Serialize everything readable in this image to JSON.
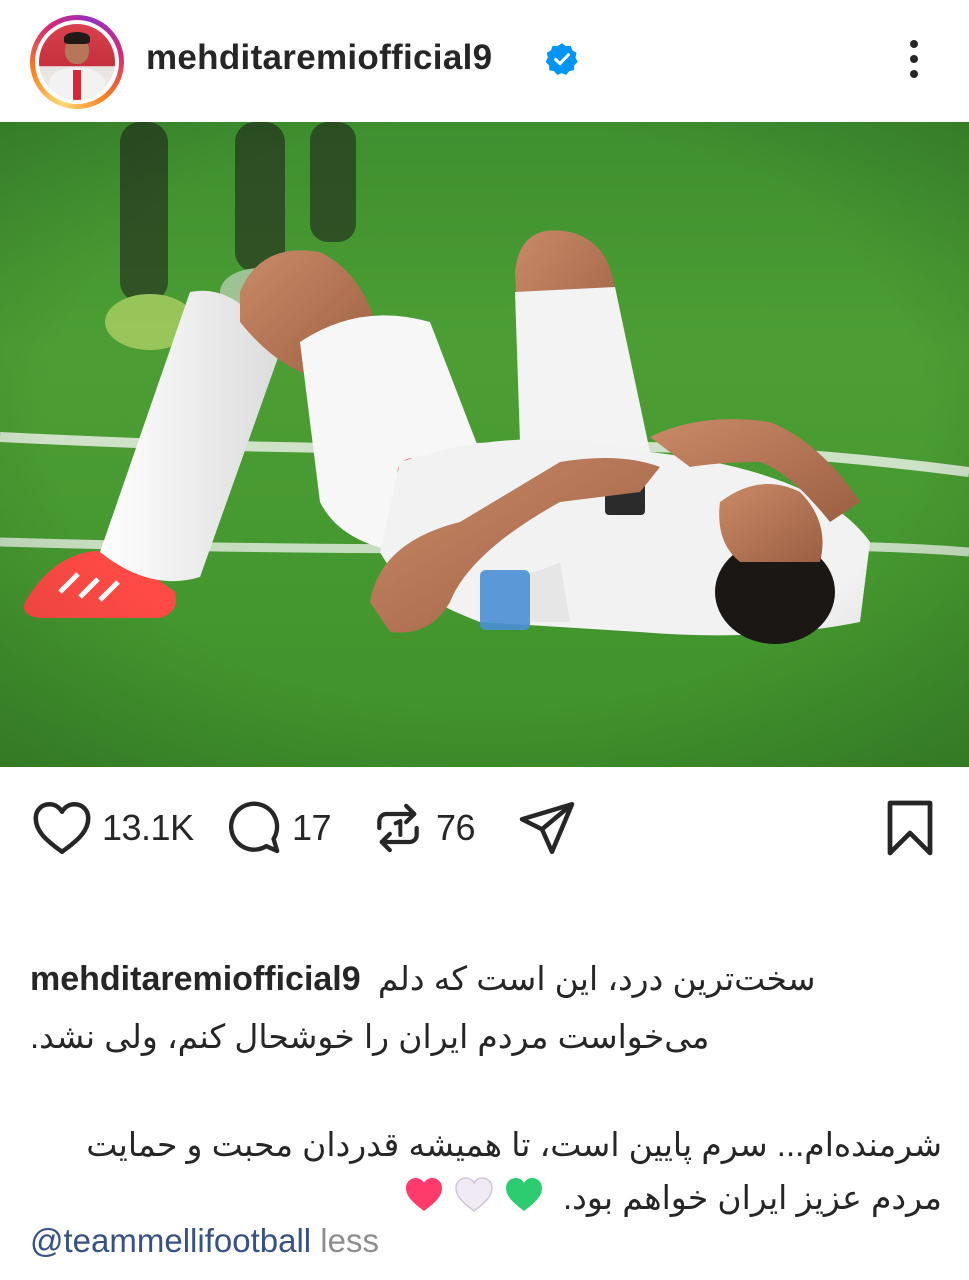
{
  "post": {
    "username": "mehditaremiofficial9",
    "verified": true,
    "avatar_icon": "profile-avatar",
    "more_icon": "more-vertical-icon"
  },
  "actions": {
    "likes": "13.1K",
    "comments": "17",
    "reposts": "76",
    "icons": [
      "heart-icon",
      "comment-icon",
      "repost-icon",
      "share-icon",
      "bookmark-icon"
    ]
  },
  "caption": {
    "username": "mehditaremiofficial9",
    "line1": "سخت‌ترین درد، این است که دلم",
    "line2": "می‌خواست مردم ایران را خوشحال کنم، ولی نشد.",
    "line3": "شرمنده‌ام... سرم پایین است،  تا همیشه قدردان محبت و حمایت",
    "line4": "مردم عزیز ایران خواهم بود.",
    "hearts": [
      "green",
      "white",
      "red"
    ],
    "mention": "@teammellifootball",
    "less": "less"
  },
  "colors": {
    "text": "#262626",
    "verified_blue": "#0095f6",
    "mention_blue": "#385185",
    "muted": "#8e8e8e",
    "heart_green": "#2ecc71",
    "heart_white": "#e8e4ef",
    "heart_red": "#ff3b6b"
  }
}
